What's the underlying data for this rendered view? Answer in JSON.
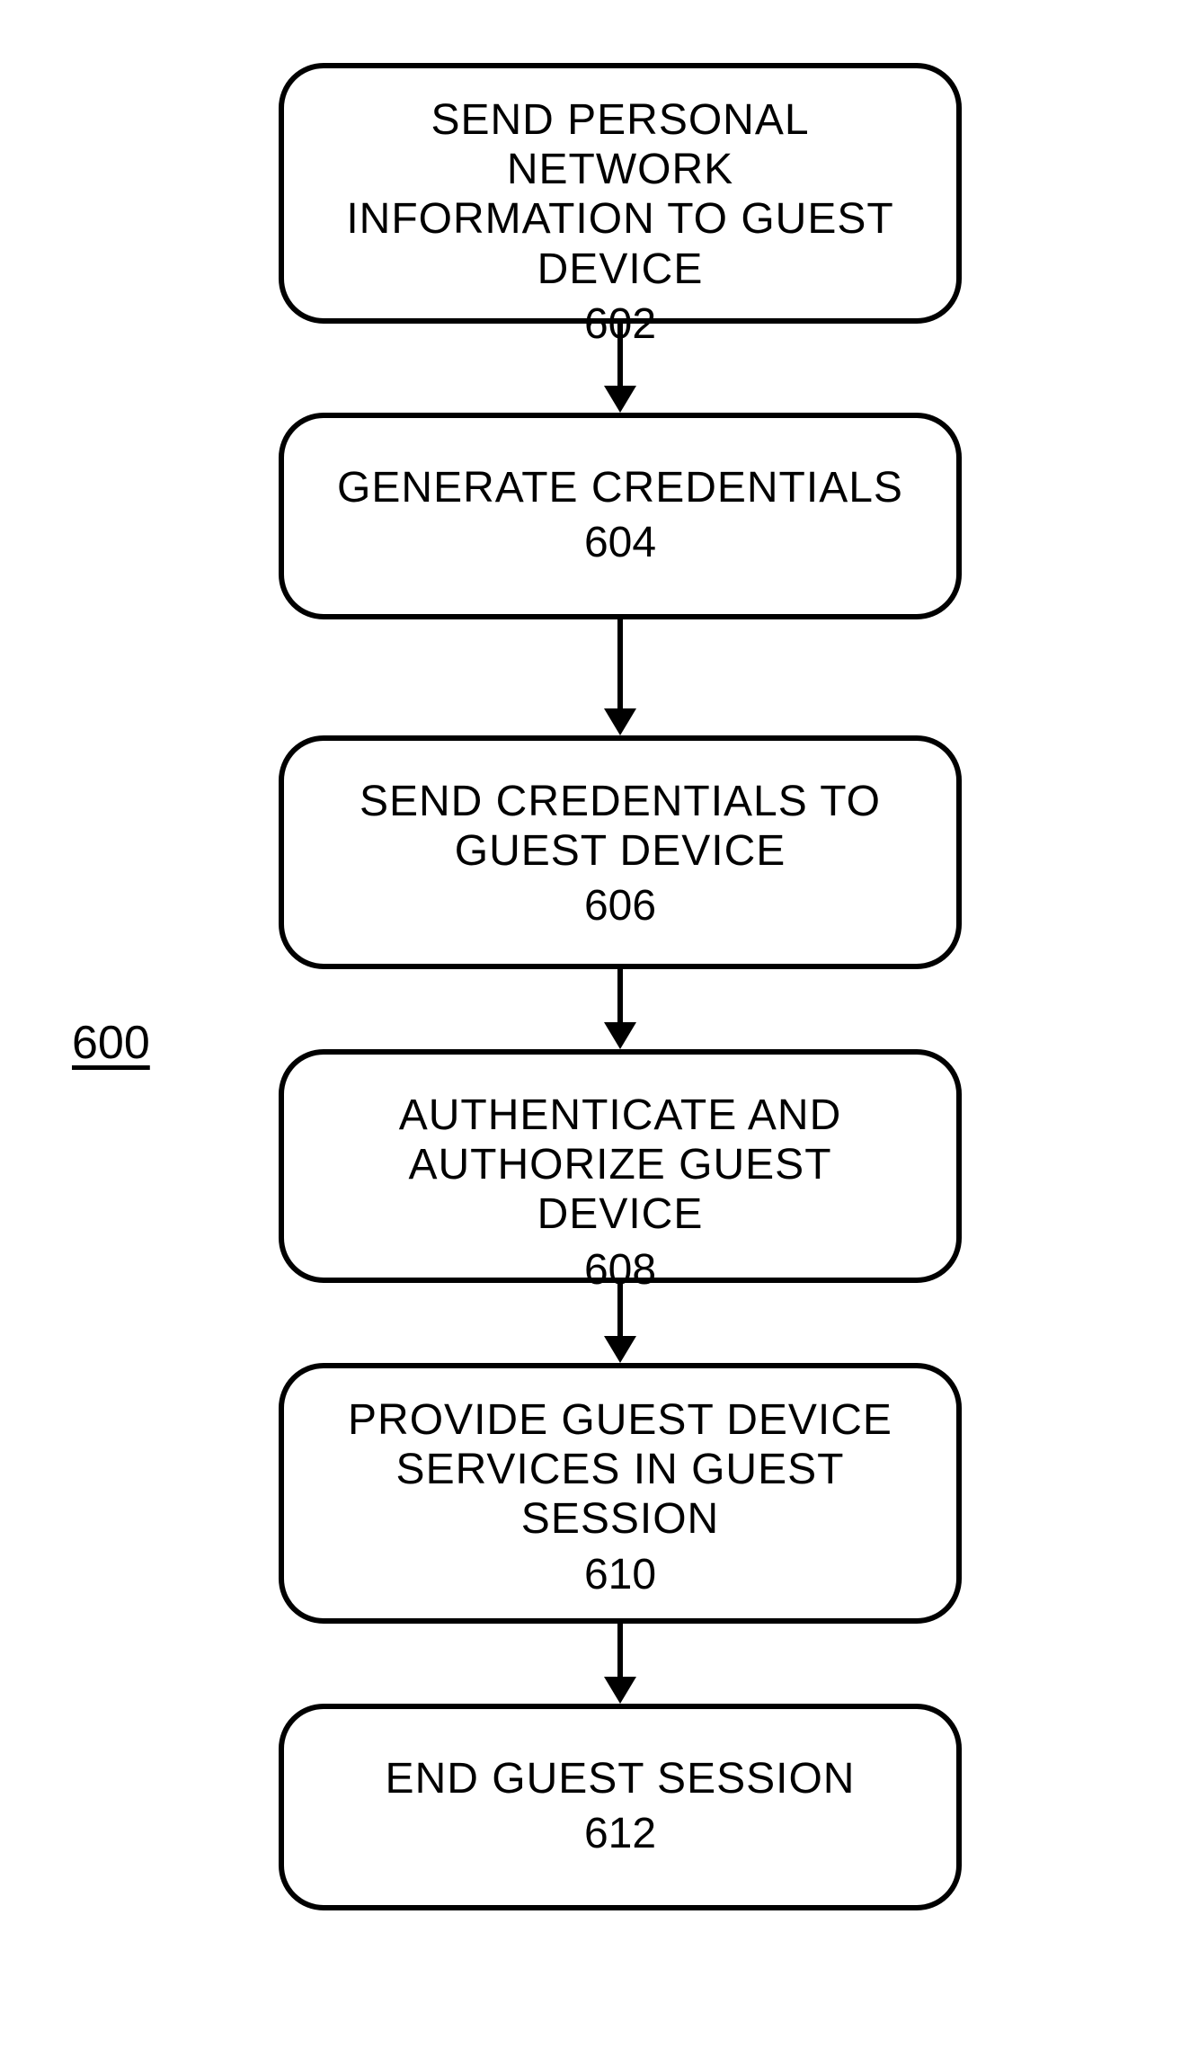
{
  "figure_label": "600",
  "steps": [
    {
      "label": "SEND PERSONAL NETWORK\nINFORMATION TO GUEST\nDEVICE",
      "num": "602"
    },
    {
      "label": "GENERATE CREDENTIALS",
      "num": "604"
    },
    {
      "label": "SEND CREDENTIALS TO\nGUEST DEVICE",
      "num": "606"
    },
    {
      "label": "AUTHENTICATE AND\nAUTHORIZE GUEST DEVICE",
      "num": "608"
    },
    {
      "label": "PROVIDE GUEST DEVICE\nSERVICES IN GUEST\nSESSION",
      "num": "610"
    },
    {
      "label": "END GUEST SESSION",
      "num": "612"
    }
  ],
  "layout": {
    "node_heights": [
      290,
      230,
      260,
      260,
      290,
      230
    ],
    "arrow_shaft_heights": [
      70,
      100,
      60,
      60,
      60
    ]
  }
}
